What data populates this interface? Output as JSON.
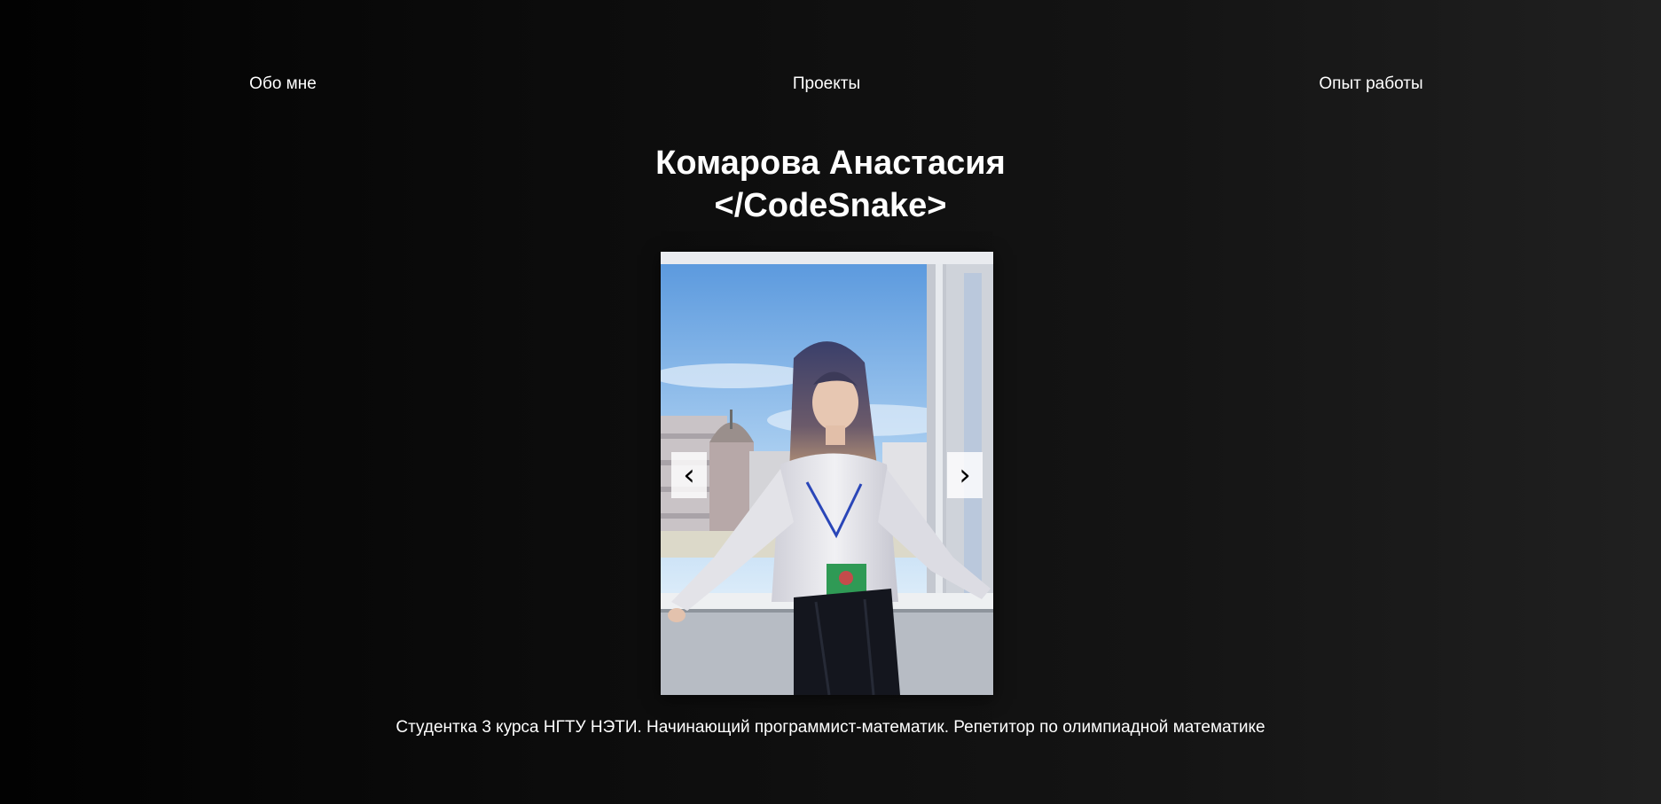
{
  "nav": {
    "about": "Обо мне",
    "projects": "Проекты",
    "experience": "Опыт работы"
  },
  "header": {
    "name": "Комарова Анастасия",
    "alias": "</CodeSnake>"
  },
  "carousel": {
    "prev_icon": "‹",
    "next_icon": "›",
    "photo_alt": "Комарова Анастасия"
  },
  "bio": "Студентка 3 курса НГТУ НЭТИ. Начинающий программист-математик. Репетитор по олимпиадной математике",
  "colors": {
    "background_start": "#020202",
    "background_end": "#202020",
    "text": "#ffffff",
    "button_bg": "#ffffff"
  }
}
